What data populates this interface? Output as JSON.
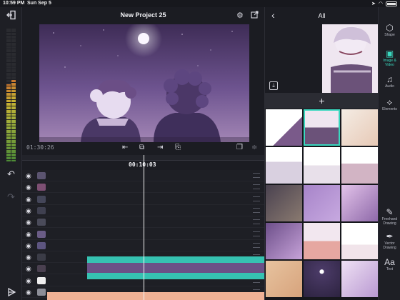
{
  "status_bar": {
    "time": "10:59 PM",
    "date": "Sun Sep 5",
    "battery_label": "battery"
  },
  "project": {
    "title": "New Project 25"
  },
  "controls": {
    "timecode": "01:30:26",
    "playhead_time": "00:10:03"
  },
  "library": {
    "title": "All",
    "add_label": "+"
  },
  "tools": [
    {
      "label": "Shape",
      "icon": "shapes-icon"
    },
    {
      "label": "Image & Video",
      "icon": "image-icon"
    },
    {
      "label": "Audio",
      "icon": "music-icon"
    },
    {
      "label": "Elements",
      "icon": "elements-icon"
    },
    {
      "label": "Freehand Drawing",
      "icon": "brush-icon"
    },
    {
      "label": "Vector Drawing",
      "icon": "pen-icon"
    },
    {
      "label": "Text",
      "icon": "text-icon"
    }
  ],
  "layers": [
    {
      "name": "layer-1"
    },
    {
      "name": "layer-2"
    },
    {
      "name": "layer-3"
    },
    {
      "name": "layer-4"
    },
    {
      "name": "layer-5"
    },
    {
      "name": "layer-6"
    },
    {
      "name": "layer-7"
    },
    {
      "name": "layer-8"
    },
    {
      "name": "layer-9"
    },
    {
      "name": "layer-10"
    },
    {
      "name": "layer-11"
    }
  ],
  "colors": {
    "accent": "#3ad8bf",
    "clip_teal": "#36c2b2",
    "clip_peach": "#f0b296",
    "scene_purple": "#6a4f86"
  },
  "meters": {
    "left_level": 0.58,
    "right_level": 0.62
  },
  "grid_items": [
    "media-1",
    "media-2",
    "media-3",
    "media-4",
    "media-5",
    "media-6",
    "media-7",
    "media-8",
    "media-9",
    "media-10",
    "media-11",
    "media-12",
    "media-13",
    "media-14",
    "media-15"
  ]
}
